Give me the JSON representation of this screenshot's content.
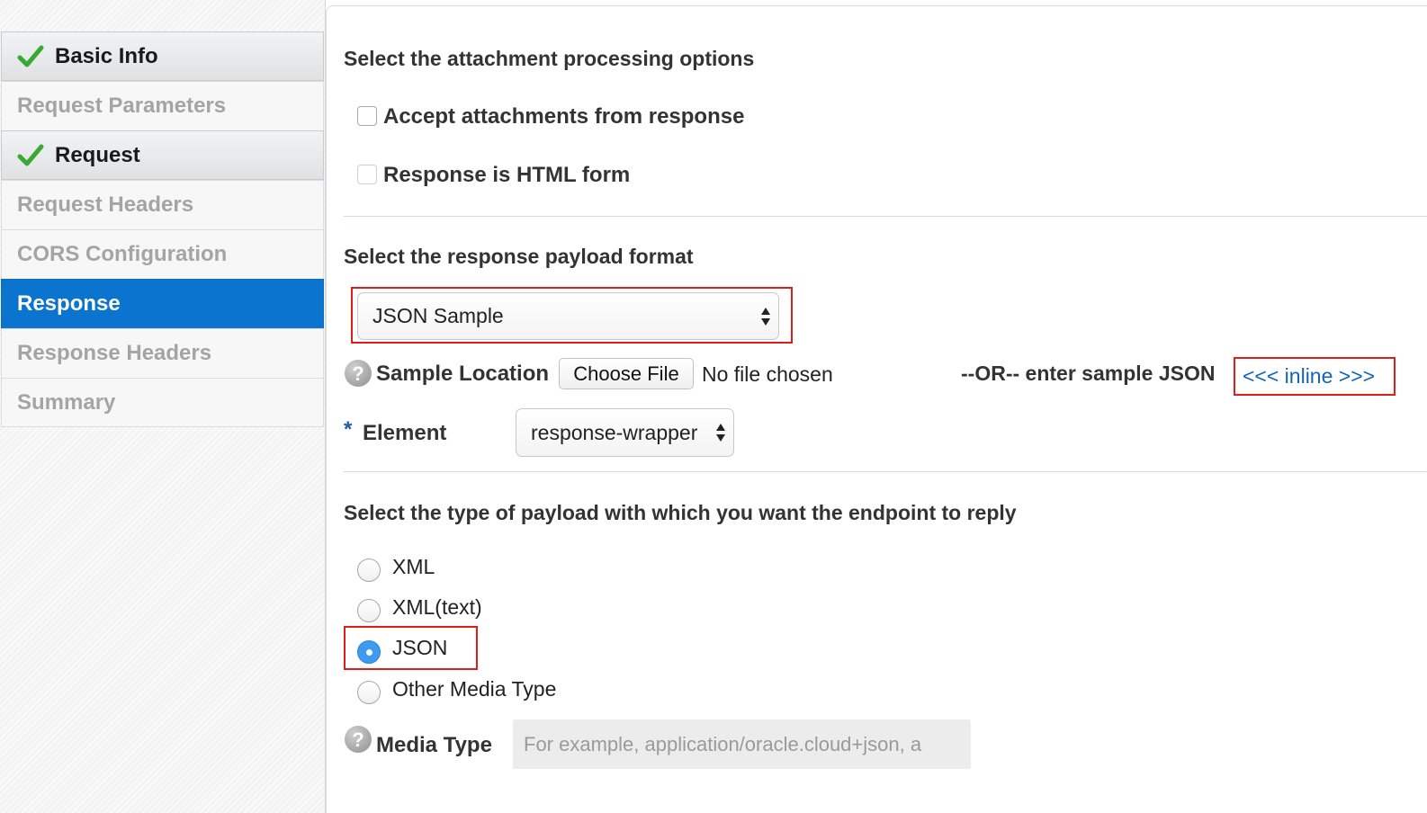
{
  "sidebar": {
    "items": [
      {
        "label": "Basic Info",
        "state": "done"
      },
      {
        "label": "Request Parameters",
        "state": "disabled"
      },
      {
        "label": "Request",
        "state": "done"
      },
      {
        "label": "Request Headers",
        "state": "disabled"
      },
      {
        "label": "CORS Configuration",
        "state": "disabled"
      },
      {
        "label": "Response",
        "state": "active"
      },
      {
        "label": "Response Headers",
        "state": "disabled"
      },
      {
        "label": "Summary",
        "state": "disabled"
      }
    ]
  },
  "attachments": {
    "title": "Select the attachment processing options",
    "accept_label": "Accept attachments from response",
    "accept_checked": false,
    "html_form_label": "Response is HTML form",
    "html_form_checked": false
  },
  "payload_format": {
    "title": "Select the response payload format",
    "selected": "JSON Sample",
    "sample_location_label": "Sample Location",
    "help_glyph": "?",
    "choose_file_label": "Choose File",
    "no_file_text": "No file chosen",
    "or_text": "--OR-- enter sample JSON",
    "inline_link": "<<< inline >>>",
    "required_marker": "*",
    "element_label": "Element",
    "element_selected": "response-wrapper"
  },
  "reply_type": {
    "title": "Select the type of payload with which you want the endpoint to reply",
    "options": [
      {
        "label": "XML",
        "checked": false
      },
      {
        "label": "XML(text)",
        "checked": false
      },
      {
        "label": "JSON",
        "checked": true
      },
      {
        "label": "Other Media Type",
        "checked": false
      }
    ],
    "media_type_label": "Media Type",
    "media_type_placeholder": "For example, application/oracle.cloud+json, a",
    "media_type_value": ""
  },
  "colors": {
    "active_nav": "#0a74cf",
    "highlight_border": "#e21b1b",
    "link": "#1463b6",
    "radio_checked": "#3c9bf0",
    "check_icon": "#3aa835"
  },
  "icons": [
    "checkmark-icon",
    "help-icon",
    "select-arrows-icon"
  ]
}
